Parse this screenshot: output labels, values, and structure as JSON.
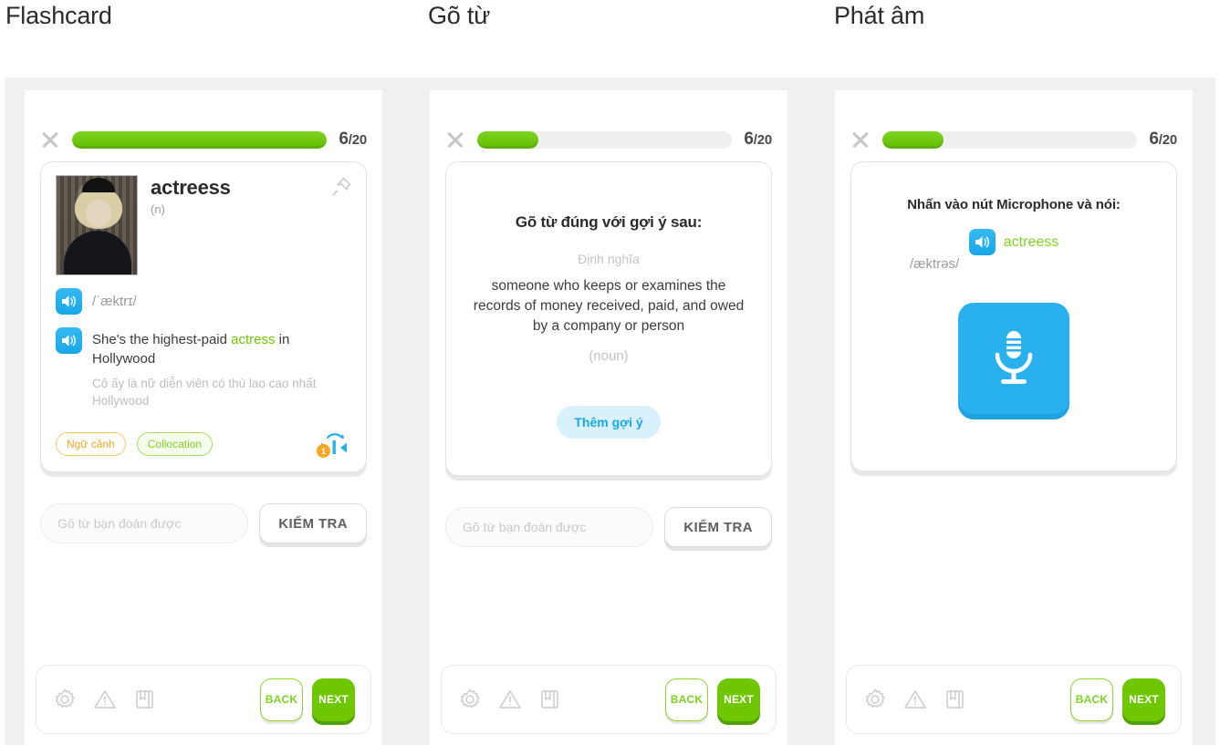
{
  "sections": [
    {
      "title": "Flashcard"
    },
    {
      "title": "Gõ từ"
    },
    {
      "title": "Phát âm"
    }
  ],
  "progress": {
    "current": "6",
    "separator": "/",
    "total": "20",
    "card1_percent": 100,
    "card2_percent": 24,
    "card3_percent": 24
  },
  "flashcard": {
    "headword": "actreess",
    "part_of_speech": "(n)",
    "ipa": "/ˈæktrɪ/",
    "sentence_before": "She's the highest-paid ",
    "sentence_highlight": "actress",
    "sentence_after": " in Hollywood",
    "translation": "Cô ấy là nữ diễn viên có thù lao cao nhất Hollywood",
    "tag_context": "Ngữ cảnh",
    "tag_collocation": "Collocation",
    "flip_badge": "1",
    "pin_icon": "pin-icon",
    "speaker_icon": "speaker-icon",
    "flip_icon": "flip-cards-icon"
  },
  "typing": {
    "title": "Gõ từ đúng với gợi ý sau:",
    "hint_label": "Định nghĩa",
    "definition": "someone who keeps or examines the records of money received, paid, and owed by a company or person",
    "part_of_speech": "(noun)",
    "more_hint_button": "Thêm gợi ý"
  },
  "pronunciation": {
    "title": "Nhấn vào nút Microphone và nói:",
    "word": "actreess",
    "ipa": "/æktrəs/",
    "mic_icon": "microphone-icon",
    "speaker_icon": "speaker-icon"
  },
  "answer": {
    "placeholder": "Gõ từ bạn đoán được",
    "value": "",
    "check_label": "KIỂM TRA"
  },
  "toolbar": {
    "settings_icon": "gear-icon",
    "report_icon": "warning-triangle-icon",
    "bookmark_icon": "bookmark-book-icon",
    "back_label": "BACK",
    "next_label": "NEXT"
  },
  "colors": {
    "green": "#6ec700",
    "green_light": "#7ed321",
    "blue": "#29b1ee",
    "amber": "#f5a623",
    "grey_bg": "#f0f0f0"
  }
}
